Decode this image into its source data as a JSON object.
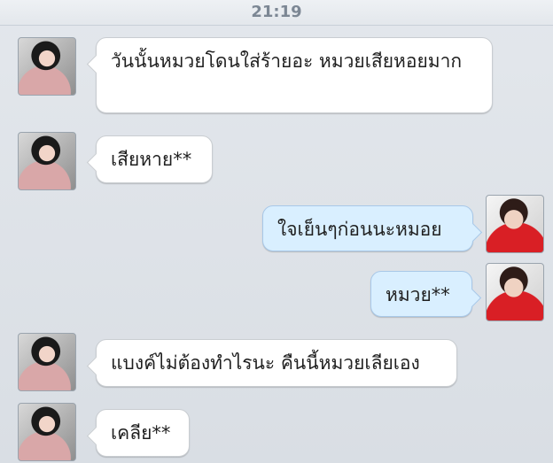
{
  "header": {
    "time": "21:19"
  },
  "messages": [
    {
      "side": "left",
      "text": "วันนั้นหมวยโดนใส่ร้ายอะ หมวยเสียหอยมาก"
    },
    {
      "side": "left",
      "text": "เสียหาย**"
    },
    {
      "side": "right",
      "text": "ใจเย็นๆก่อนนะหมอย"
    },
    {
      "side": "right",
      "text": "หมวย**"
    },
    {
      "side": "left",
      "text": "แบงค์ไม่ต้องทำไรนะ คืนนี้หมวยเลียเอง"
    },
    {
      "side": "left",
      "text": "เคลีย**"
    }
  ]
}
